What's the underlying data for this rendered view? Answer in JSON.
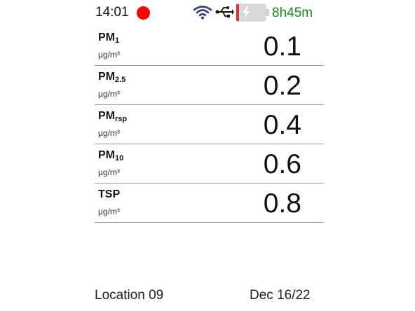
{
  "status_bar": {
    "time": "14:01",
    "battery_remaining": "8h45m",
    "icons": [
      "recording-dot-icon",
      "wifi-icon",
      "usb-icon",
      "battery-charging-icon"
    ],
    "colors": {
      "recording": "#ff0000",
      "wifi": "#3b3a8a",
      "battery_low": "#d9372f",
      "battery_time": "#1a8a1a"
    }
  },
  "readings": [
    {
      "name_main": "PM",
      "name_sub": "1",
      "unit": "µg/m³",
      "value": "0.1"
    },
    {
      "name_main": "PM",
      "name_sub": "2.5",
      "unit": "µg/m³",
      "value": "0.2"
    },
    {
      "name_main": "PM",
      "name_sub": "rsp",
      "unit": "µg/m³",
      "value": "0.4"
    },
    {
      "name_main": "PM",
      "name_sub": "10",
      "unit": "µg/m³",
      "value": "0.6"
    },
    {
      "name_main": "TSP",
      "name_sub": "",
      "unit": "µg/m³",
      "value": "0.8"
    }
  ],
  "footer": {
    "location": "Location 09",
    "date": "Dec 16/22"
  }
}
